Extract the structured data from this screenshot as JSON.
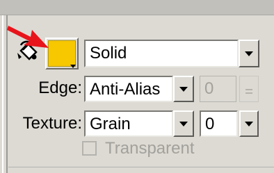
{
  "fill": {
    "swatch_color": "#f7c800",
    "pointer_color": "#e8141b",
    "style_value": "Solid"
  },
  "edge": {
    "label": "Edge:",
    "value": "Anti-Alias",
    "amount": "0"
  },
  "texture": {
    "label": "Texture:",
    "value": "Grain",
    "amount": "0"
  },
  "transparent": {
    "label": "Transparent",
    "checked": false,
    "enabled": false
  },
  "icons": [
    "paint-bucket-icon",
    "red-arrow-icon",
    "chevron-down-icon"
  ]
}
